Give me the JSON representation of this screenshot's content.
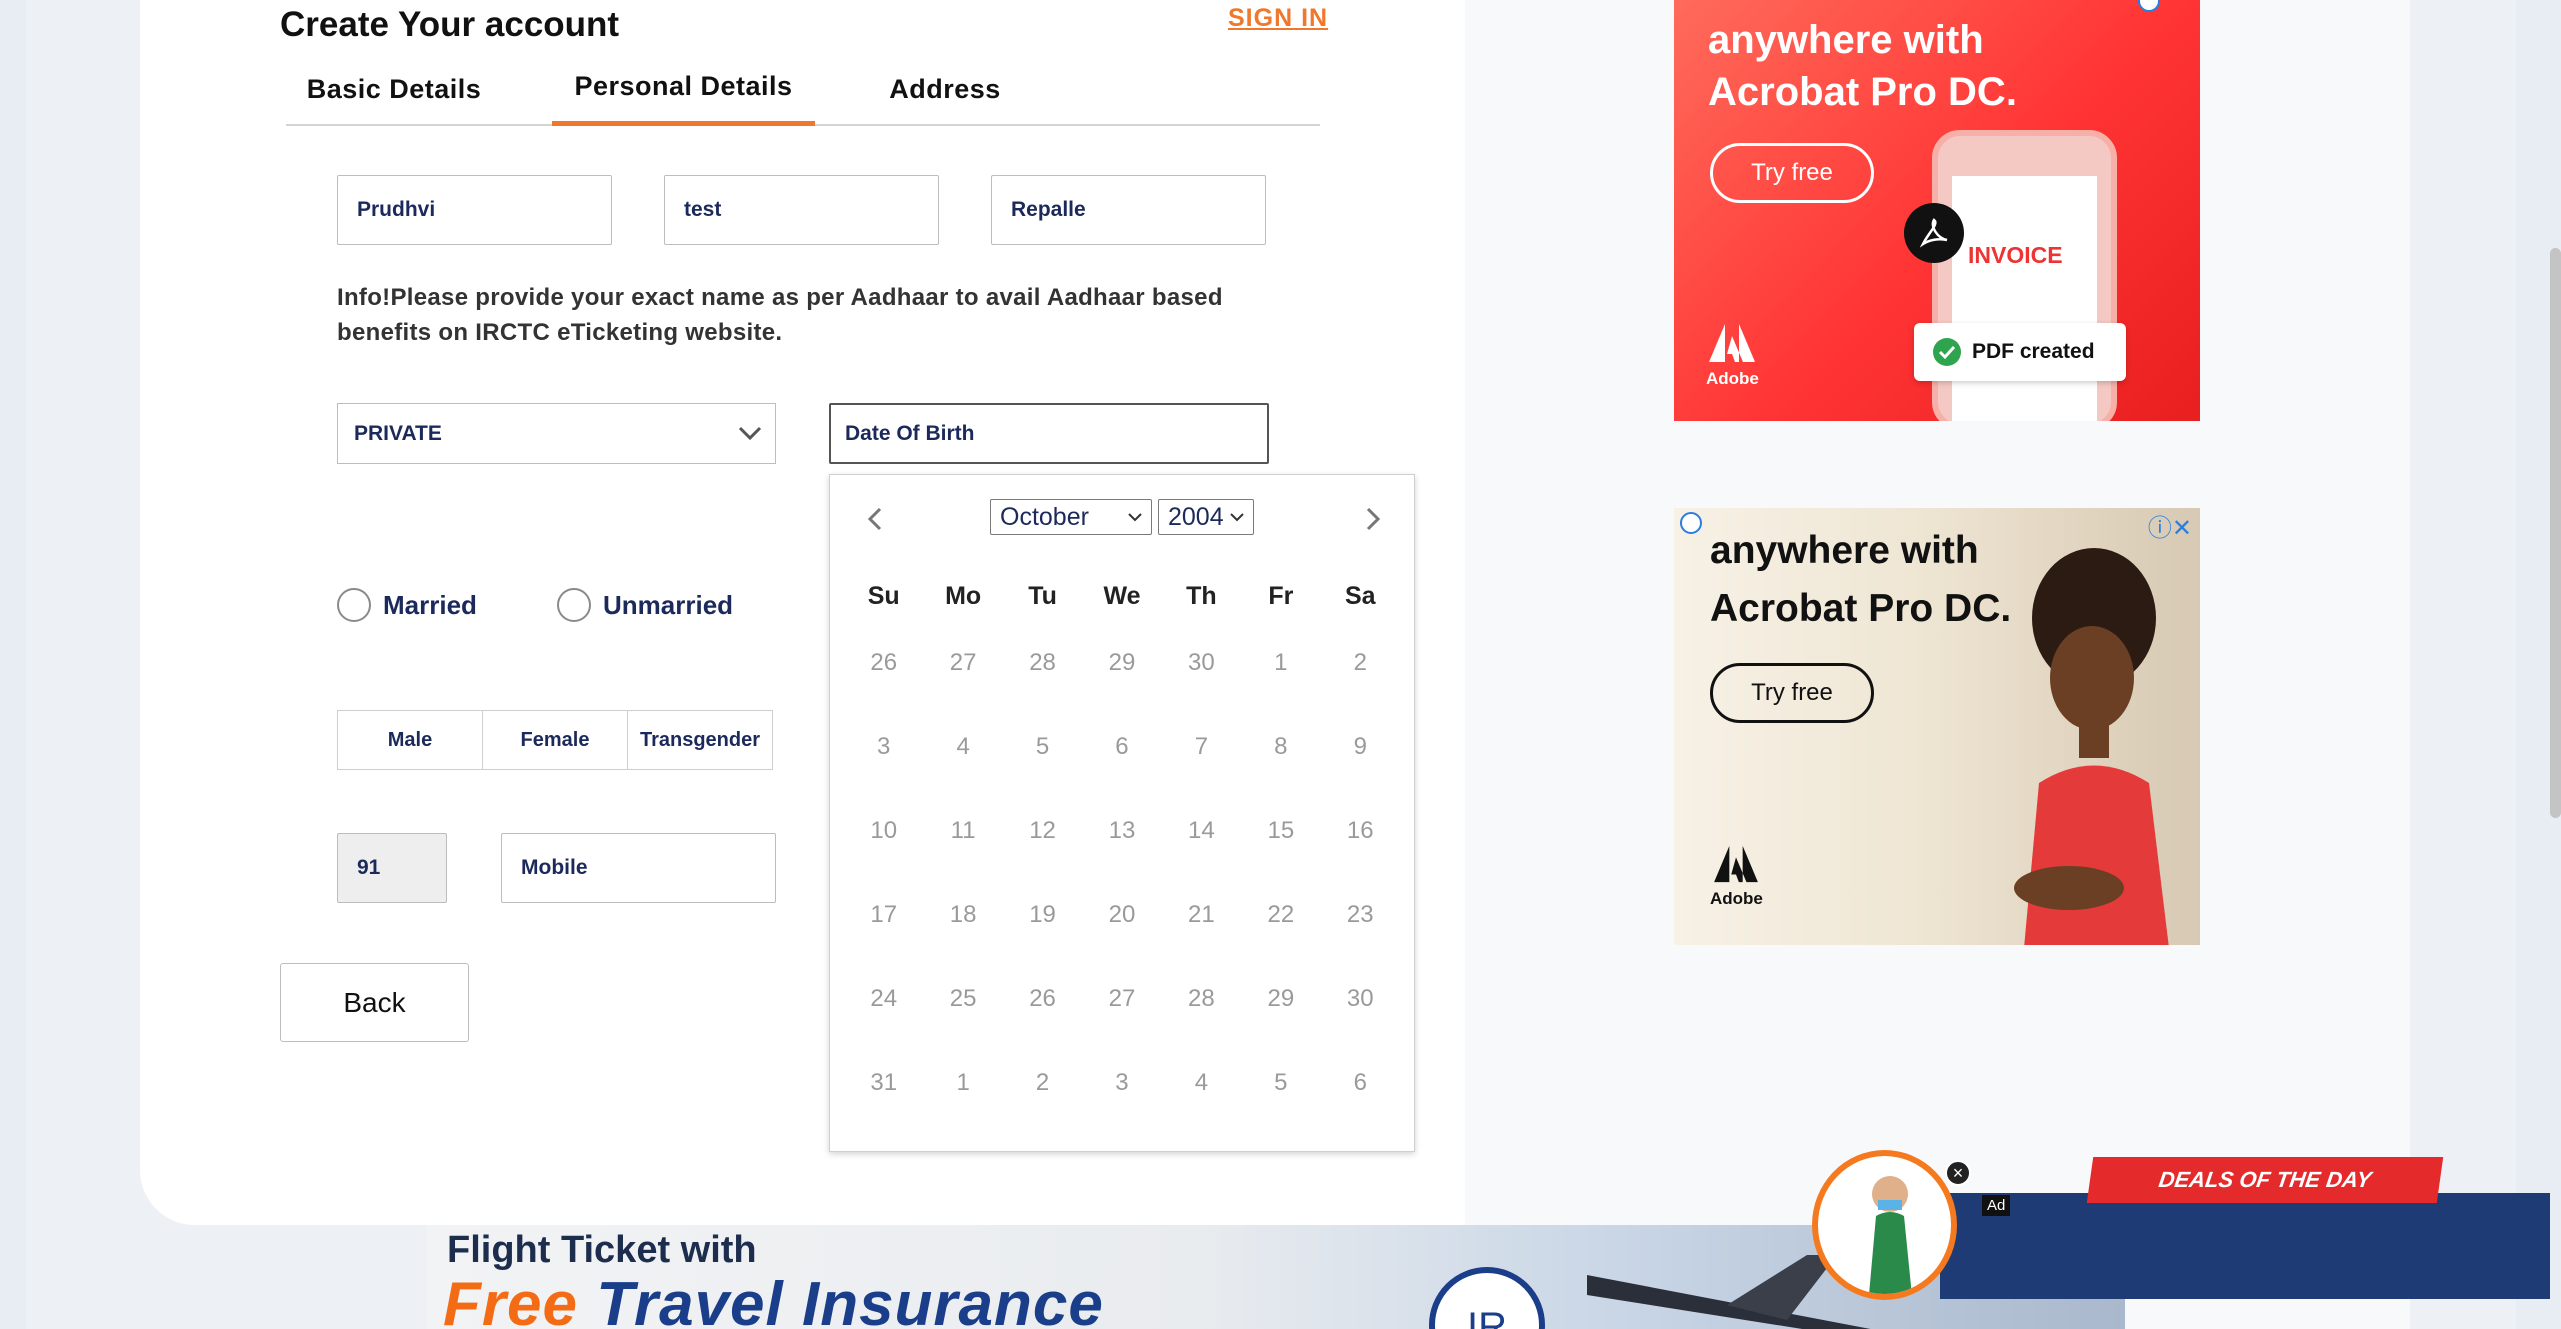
{
  "form": {
    "title": "Create Your account",
    "sign_in": "SIGN IN",
    "tabs": [
      {
        "label": "Basic Details"
      },
      {
        "label": "Personal Details"
      },
      {
        "label": "Address"
      }
    ],
    "first_name": "Prudhvi",
    "middle_name": "test",
    "last_name": "Repalle",
    "info": "Info!Please provide your exact name as per Aadhaar to avail Aadhaar based benefits on IRCTC eTicketing website.",
    "occupation": "PRIVATE",
    "dob_placeholder": "Date Of Birth",
    "married": "Married",
    "unmarried": "Unmarried",
    "gender": {
      "male": "Male",
      "female": "Female",
      "transgender": "Transgender"
    },
    "country_code": "91",
    "mobile_placeholder": "Mobile",
    "back": "Back"
  },
  "calendar": {
    "month": "October",
    "year": "2004",
    "weekdays": [
      "Su",
      "Mo",
      "Tu",
      "We",
      "Th",
      "Fr",
      "Sa"
    ],
    "weeks": [
      [
        "26",
        "27",
        "28",
        "29",
        "30",
        "1",
        "2"
      ],
      [
        "3",
        "4",
        "5",
        "6",
        "7",
        "8",
        "9"
      ],
      [
        "10",
        "11",
        "12",
        "13",
        "14",
        "15",
        "16"
      ],
      [
        "17",
        "18",
        "19",
        "20",
        "21",
        "22",
        "23"
      ],
      [
        "24",
        "25",
        "26",
        "27",
        "28",
        "29",
        "30"
      ],
      [
        "31",
        "1",
        "2",
        "3",
        "4",
        "5",
        "6"
      ]
    ]
  },
  "ads": {
    "ad1": {
      "line1": "anywhere with",
      "line2": "Acrobat Pro DC.",
      "cta": "Try free",
      "invoice": "INVOICE",
      "badge": "PDF created",
      "brand": "Adobe"
    },
    "ad2": {
      "line1": "anywhere with",
      "line2": "Acrobat Pro DC.",
      "cta": "Try free",
      "brand": "Adobe"
    },
    "banner": {
      "line1": "Flight Ticket with",
      "line2a": "Free ",
      "line2b": "Travel Insurance"
    },
    "deals": "DEALS OF THE DAY",
    "ad_tag": "Ad"
  },
  "colors": {
    "accent": "#f0782d",
    "text_primary": "#1c2a5b"
  }
}
